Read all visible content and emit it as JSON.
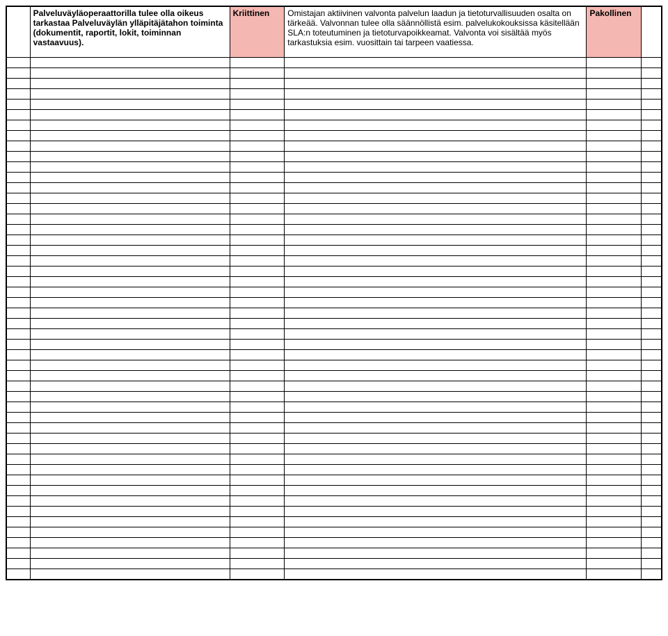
{
  "row": {
    "col1": "",
    "col2": "Palveluväyläoperaattorilla tulee olla oikeus tarkastaa Palveluväylän ylläpitäjätahon toiminta (dokumentit, raportit, lokit, toiminnan vastaavuus).",
    "col3": "Kriittinen",
    "col4": "Omistajan aktiivinen valvonta palvelun laadun ja tietoturvallisuuden osalta on tärkeää. Valvonnan tulee olla säännöllistä esim. palvelukokouksissa käsitellään SLA:n toteutuminen ja tietoturvapoikkeamat. Valvonta voi sisältää myös tarkastuksia esim. vuosittain tai tarpeen vaatiessa.",
    "col5": "Pakollinen",
    "col6": ""
  },
  "emptyRowCount": 50
}
